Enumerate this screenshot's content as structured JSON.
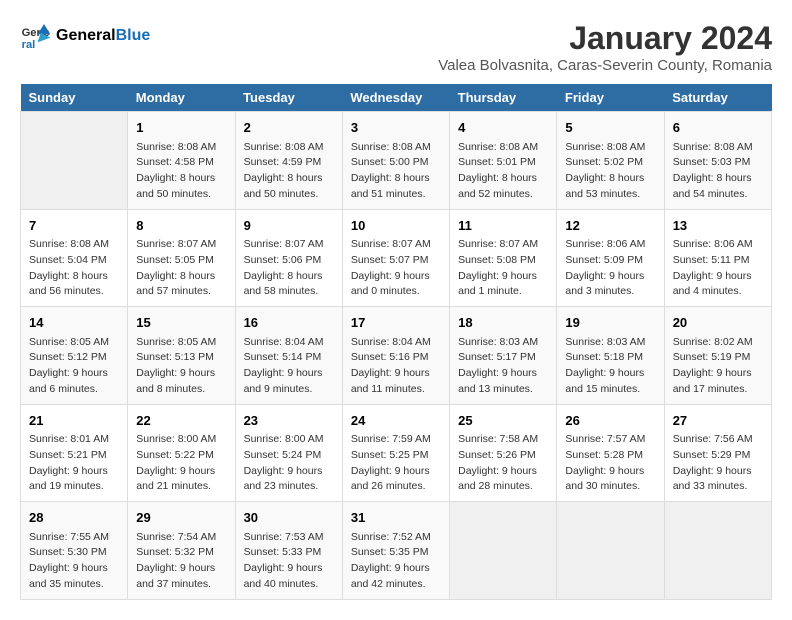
{
  "logo": {
    "general": "General",
    "blue": "Blue"
  },
  "title": "January 2024",
  "subtitle": "Valea Bolvasnita, Caras-Severin County, Romania",
  "days_of_week": [
    "Sunday",
    "Monday",
    "Tuesday",
    "Wednesday",
    "Thursday",
    "Friday",
    "Saturday"
  ],
  "weeks": [
    [
      {
        "day": "",
        "info": ""
      },
      {
        "day": "1",
        "info": "Sunrise: 8:08 AM\nSunset: 4:58 PM\nDaylight: 8 hours\nand 50 minutes."
      },
      {
        "day": "2",
        "info": "Sunrise: 8:08 AM\nSunset: 4:59 PM\nDaylight: 8 hours\nand 50 minutes."
      },
      {
        "day": "3",
        "info": "Sunrise: 8:08 AM\nSunset: 5:00 PM\nDaylight: 8 hours\nand 51 minutes."
      },
      {
        "day": "4",
        "info": "Sunrise: 8:08 AM\nSunset: 5:01 PM\nDaylight: 8 hours\nand 52 minutes."
      },
      {
        "day": "5",
        "info": "Sunrise: 8:08 AM\nSunset: 5:02 PM\nDaylight: 8 hours\nand 53 minutes."
      },
      {
        "day": "6",
        "info": "Sunrise: 8:08 AM\nSunset: 5:03 PM\nDaylight: 8 hours\nand 54 minutes."
      }
    ],
    [
      {
        "day": "7",
        "info": "Sunrise: 8:08 AM\nSunset: 5:04 PM\nDaylight: 8 hours\nand 56 minutes."
      },
      {
        "day": "8",
        "info": "Sunrise: 8:07 AM\nSunset: 5:05 PM\nDaylight: 8 hours\nand 57 minutes."
      },
      {
        "day": "9",
        "info": "Sunrise: 8:07 AM\nSunset: 5:06 PM\nDaylight: 8 hours\nand 58 minutes."
      },
      {
        "day": "10",
        "info": "Sunrise: 8:07 AM\nSunset: 5:07 PM\nDaylight: 9 hours\nand 0 minutes."
      },
      {
        "day": "11",
        "info": "Sunrise: 8:07 AM\nSunset: 5:08 PM\nDaylight: 9 hours\nand 1 minute."
      },
      {
        "day": "12",
        "info": "Sunrise: 8:06 AM\nSunset: 5:09 PM\nDaylight: 9 hours\nand 3 minutes."
      },
      {
        "day": "13",
        "info": "Sunrise: 8:06 AM\nSunset: 5:11 PM\nDaylight: 9 hours\nand 4 minutes."
      }
    ],
    [
      {
        "day": "14",
        "info": "Sunrise: 8:05 AM\nSunset: 5:12 PM\nDaylight: 9 hours\nand 6 minutes."
      },
      {
        "day": "15",
        "info": "Sunrise: 8:05 AM\nSunset: 5:13 PM\nDaylight: 9 hours\nand 8 minutes."
      },
      {
        "day": "16",
        "info": "Sunrise: 8:04 AM\nSunset: 5:14 PM\nDaylight: 9 hours\nand 9 minutes."
      },
      {
        "day": "17",
        "info": "Sunrise: 8:04 AM\nSunset: 5:16 PM\nDaylight: 9 hours\nand 11 minutes."
      },
      {
        "day": "18",
        "info": "Sunrise: 8:03 AM\nSunset: 5:17 PM\nDaylight: 9 hours\nand 13 minutes."
      },
      {
        "day": "19",
        "info": "Sunrise: 8:03 AM\nSunset: 5:18 PM\nDaylight: 9 hours\nand 15 minutes."
      },
      {
        "day": "20",
        "info": "Sunrise: 8:02 AM\nSunset: 5:19 PM\nDaylight: 9 hours\nand 17 minutes."
      }
    ],
    [
      {
        "day": "21",
        "info": "Sunrise: 8:01 AM\nSunset: 5:21 PM\nDaylight: 9 hours\nand 19 minutes."
      },
      {
        "day": "22",
        "info": "Sunrise: 8:00 AM\nSunset: 5:22 PM\nDaylight: 9 hours\nand 21 minutes."
      },
      {
        "day": "23",
        "info": "Sunrise: 8:00 AM\nSunset: 5:24 PM\nDaylight: 9 hours\nand 23 minutes."
      },
      {
        "day": "24",
        "info": "Sunrise: 7:59 AM\nSunset: 5:25 PM\nDaylight: 9 hours\nand 26 minutes."
      },
      {
        "day": "25",
        "info": "Sunrise: 7:58 AM\nSunset: 5:26 PM\nDaylight: 9 hours\nand 28 minutes."
      },
      {
        "day": "26",
        "info": "Sunrise: 7:57 AM\nSunset: 5:28 PM\nDaylight: 9 hours\nand 30 minutes."
      },
      {
        "day": "27",
        "info": "Sunrise: 7:56 AM\nSunset: 5:29 PM\nDaylight: 9 hours\nand 33 minutes."
      }
    ],
    [
      {
        "day": "28",
        "info": "Sunrise: 7:55 AM\nSunset: 5:30 PM\nDaylight: 9 hours\nand 35 minutes."
      },
      {
        "day": "29",
        "info": "Sunrise: 7:54 AM\nSunset: 5:32 PM\nDaylight: 9 hours\nand 37 minutes."
      },
      {
        "day": "30",
        "info": "Sunrise: 7:53 AM\nSunset: 5:33 PM\nDaylight: 9 hours\nand 40 minutes."
      },
      {
        "day": "31",
        "info": "Sunrise: 7:52 AM\nSunset: 5:35 PM\nDaylight: 9 hours\nand 42 minutes."
      },
      {
        "day": "",
        "info": ""
      },
      {
        "day": "",
        "info": ""
      },
      {
        "day": "",
        "info": ""
      }
    ]
  ]
}
